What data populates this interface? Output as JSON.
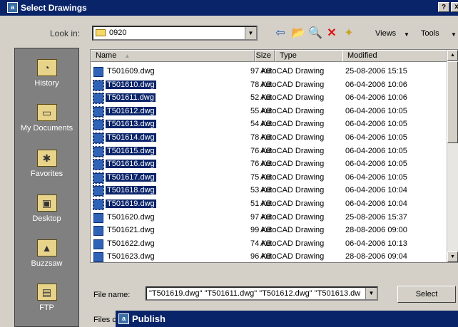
{
  "window": {
    "title": "Select Drawings",
    "help_btn": "?",
    "close_btn": "x"
  },
  "lookin": {
    "label": "Look in:",
    "value": "0920"
  },
  "toolbar": {
    "views_label": "Views",
    "tools_label": "Tools"
  },
  "places": [
    {
      "label": "History",
      "icon": "history-icon"
    },
    {
      "label": "My Documents",
      "icon": "my-documents-icon"
    },
    {
      "label": "Favorites",
      "icon": "favorites-icon"
    },
    {
      "label": "Desktop",
      "icon": "desktop-icon"
    },
    {
      "label": "Buzzsaw",
      "icon": "buzzsaw-icon"
    },
    {
      "label": "FTP",
      "icon": "ftp-icon"
    }
  ],
  "columns": {
    "name": "Name",
    "size": "Size",
    "type": "Type",
    "modified": "Modified"
  },
  "files": [
    {
      "name": "T501609.dwg",
      "size": "97 KB",
      "type": "AutoCAD Drawing",
      "modified": "25-08-2006 15:15",
      "selected": false
    },
    {
      "name": "T501610.dwg",
      "size": "78 KB",
      "type": "AutoCAD Drawing",
      "modified": "06-04-2006 10:06",
      "selected": true
    },
    {
      "name": "T501611.dwg",
      "size": "52 KB",
      "type": "AutoCAD Drawing",
      "modified": "06-04-2006 10:06",
      "selected": true
    },
    {
      "name": "T501612.dwg",
      "size": "55 KB",
      "type": "AutoCAD Drawing",
      "modified": "06-04-2006 10:05",
      "selected": true
    },
    {
      "name": "T501613.dwg",
      "size": "54 KB",
      "type": "AutoCAD Drawing",
      "modified": "06-04-2006 10:05",
      "selected": true
    },
    {
      "name": "T501614.dwg",
      "size": "78 KB",
      "type": "AutoCAD Drawing",
      "modified": "06-04-2006 10:05",
      "selected": true
    },
    {
      "name": "T501615.dwg",
      "size": "76 KB",
      "type": "AutoCAD Drawing",
      "modified": "06-04-2006 10:05",
      "selected": true
    },
    {
      "name": "T501616.dwg",
      "size": "76 KB",
      "type": "AutoCAD Drawing",
      "modified": "06-04-2006 10:05",
      "selected": true
    },
    {
      "name": "T501617.dwg",
      "size": "75 KB",
      "type": "AutoCAD Drawing",
      "modified": "06-04-2006 10:05",
      "selected": true
    },
    {
      "name": "T501618.dwg",
      "size": "53 KB",
      "type": "AutoCAD Drawing",
      "modified": "06-04-2006 10:04",
      "selected": true
    },
    {
      "name": "T501619.dwg",
      "size": "51 KB",
      "type": "AutoCAD Drawing",
      "modified": "06-04-2006 10:04",
      "selected": true
    },
    {
      "name": "T501620.dwg",
      "size": "97 KB",
      "type": "AutoCAD Drawing",
      "modified": "25-08-2006 15:37",
      "selected": false
    },
    {
      "name": "T501621.dwg",
      "size": "99 KB",
      "type": "AutoCAD Drawing",
      "modified": "28-08-2006 09:00",
      "selected": false
    },
    {
      "name": "T501622.dwg",
      "size": "74 KB",
      "type": "AutoCAD Drawing",
      "modified": "06-04-2006 10:13",
      "selected": false
    },
    {
      "name": "T501623.dwg",
      "size": "96 KB",
      "type": "AutoCAD Drawing",
      "modified": "28-08-2006 09:04",
      "selected": false
    }
  ],
  "filename": {
    "label": "File name:",
    "value": "\"T501619.dwg\" \"T501611.dwg\" \"T501612.dwg\" \"T501613.dw"
  },
  "select_label": "Select",
  "files_of_label": "Files c",
  "publish_title": "Publish",
  "colors": {
    "title_bar": "#0a246a",
    "selection": "#0a246a",
    "dialog_bg": "#d4d0c8",
    "places_bg": "#808080"
  }
}
